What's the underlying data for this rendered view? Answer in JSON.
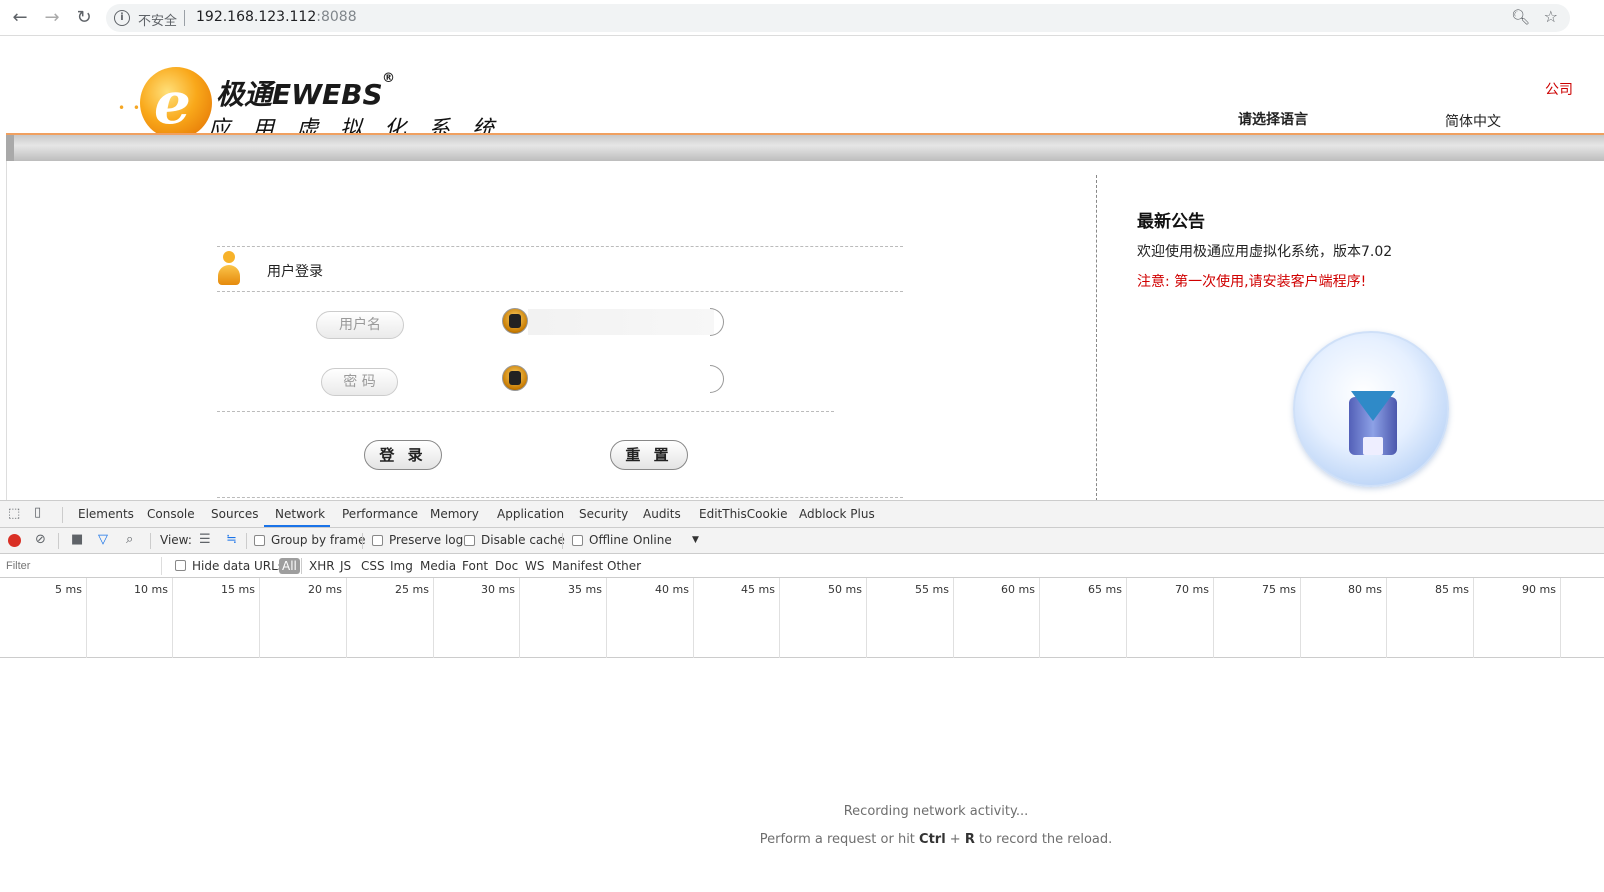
{
  "browser": {
    "back_glyph": "←",
    "forward_glyph": "→",
    "reload_glyph": "↻",
    "security_text": "不安全",
    "url_host": "192.168.123.112",
    "url_port": ":8088"
  },
  "header": {
    "logo_title": "极通EWEBS",
    "logo_reg": "®",
    "logo_subtitle": "应用虚拟化系统",
    "language_label": "请选择语言",
    "language_value": "简体中文",
    "top_right_partial": "公司"
  },
  "login": {
    "title": "用户登录",
    "username_label": "用户名",
    "password_label": "密 码",
    "username_value": "",
    "password_value": "",
    "login_button": "登 录",
    "reset_button": "重 置"
  },
  "news": {
    "title": "最新公告",
    "line1": "欢迎使用极通应用虚拟化系统，版本7.02",
    "line2": "注意: 第一次使用,请安装客户端程序!"
  },
  "devtools": {
    "tabs": [
      "Elements",
      "Console",
      "Sources",
      "Network",
      "Performance",
      "Memory",
      "Application",
      "Security",
      "Audits",
      "EditThisCookie",
      "Adblock Plus"
    ],
    "active_tab": "Network",
    "toolbar": {
      "view_label": "View:",
      "group_by_frame": "Group by frame",
      "preserve_log": "Preserve log",
      "disable_cache": "Disable cache",
      "offline": "Offline",
      "throttle": "Online"
    },
    "filter": {
      "placeholder": "Filter",
      "hide_data_urls": "Hide data URLs",
      "types": [
        "All",
        "XHR",
        "JS",
        "CSS",
        "Img",
        "Media",
        "Font",
        "Doc",
        "WS",
        "Manifest",
        "Other"
      ]
    },
    "timeline_ticks": [
      "5 ms",
      "10 ms",
      "15 ms",
      "20 ms",
      "25 ms",
      "30 ms",
      "35 ms",
      "40 ms",
      "45 ms",
      "50 ms",
      "55 ms",
      "60 ms",
      "65 ms",
      "70 ms",
      "75 ms",
      "80 ms",
      "85 ms",
      "90 ms"
    ],
    "empty_msg_1": "Recording network activity...",
    "empty_msg_2_pre": "Perform a request or hit ",
    "empty_msg_2_key1": "Ctrl",
    "empty_msg_2_plus": " + ",
    "empty_msg_2_key2": "R",
    "empty_msg_2_post": " to record the reload."
  }
}
